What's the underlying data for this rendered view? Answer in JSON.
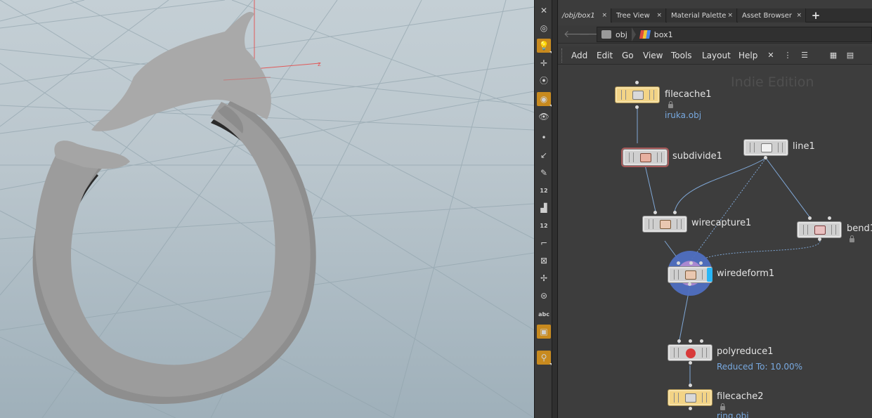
{
  "tabs": [
    {
      "label": "/obj/box1",
      "close": "×"
    },
    {
      "label": "Tree View",
      "close": "×"
    },
    {
      "label": "Material Palette",
      "close": "×"
    },
    {
      "label": "Asset Browser",
      "close": "×"
    }
  ],
  "new_tab": "+",
  "path": {
    "root": "obj",
    "current": "box1"
  },
  "menu": [
    "Add",
    "Edit",
    "Go",
    "View",
    "Tools",
    "Layout",
    "Help"
  ],
  "watermark": "Indie Edition",
  "nodes": {
    "filecache1": {
      "name": "filecache1",
      "info": "iruka.obj"
    },
    "subdivide1": {
      "name": "subdivide1"
    },
    "line1": {
      "name": "line1"
    },
    "wirecapture1": {
      "name": "wirecapture1"
    },
    "bend1": {
      "name": "bend1"
    },
    "wiredeform1": {
      "name": "wiredeform1"
    },
    "polyreduce1": {
      "name": "polyreduce1",
      "info": "Reduced To: 10.00%"
    },
    "filecache2": {
      "name": "filecache2",
      "info": "ring.obj"
    }
  },
  "viewer_toolbar": {
    "labels": {
      "point_numbers": "12",
      "prim_numbers": "12",
      "text": "abc"
    },
    "icons": [
      "close-icon",
      "camera-icon",
      "light-icon",
      "handle-icon",
      "snap-icon",
      "display-options-icon",
      "visibility-icon",
      "point-icon",
      "normal-icon",
      "vertex-icon",
      "point-numbers-icon",
      "brush-icon",
      "prim-numbers-icon",
      "axis-icon",
      "bounding-box-icon",
      "vector-icon",
      "fill-icon",
      "text-icon",
      "background-image-icon",
      "pin-icon"
    ]
  },
  "colors": {
    "accent": "#c88a1e",
    "display_flag": "#29b6f6",
    "info_text": "#78a9e0",
    "file_node": "#f3d486"
  }
}
